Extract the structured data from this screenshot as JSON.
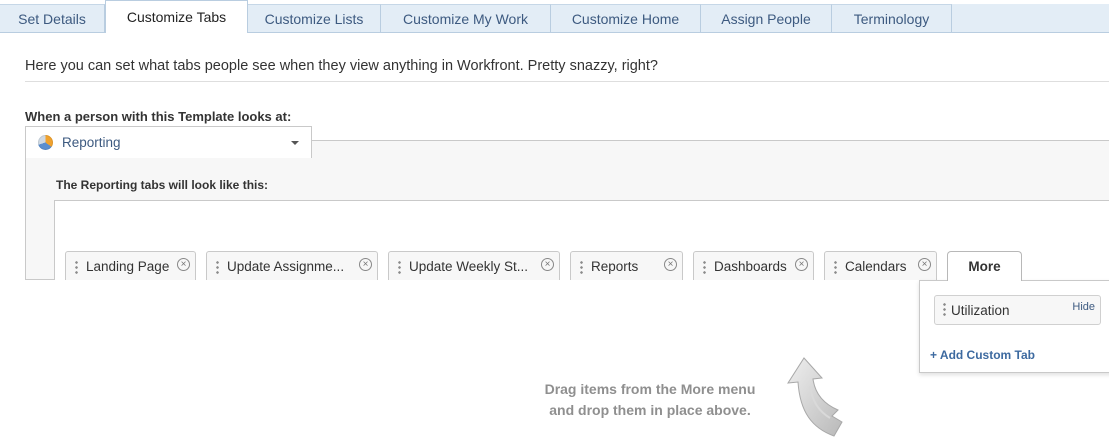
{
  "tabs": [
    {
      "label": "Set Details",
      "active": false
    },
    {
      "label": "Customize Tabs",
      "active": true
    },
    {
      "label": "Customize Lists",
      "active": false
    },
    {
      "label": "Customize My Work",
      "active": false
    },
    {
      "label": "Customize Home",
      "active": false
    },
    {
      "label": "Assign People",
      "active": false
    },
    {
      "label": "Terminology",
      "active": false
    }
  ],
  "intro": "Here you can set what tabs people see when they view anything in Workfront. Pretty snazzy, right?",
  "when_label": "When a person with this Template looks at:",
  "object_select": {
    "value": "Reporting",
    "icon": "reporting-pie-icon"
  },
  "preview_label": "The Reporting tabs will look like this:",
  "preview_tabs": [
    {
      "label": "Landing Page"
    },
    {
      "label": "Update Assignme..."
    },
    {
      "label": "Update Weekly St..."
    },
    {
      "label": "Reports"
    },
    {
      "label": "Dashboards"
    },
    {
      "label": "Calendars"
    }
  ],
  "more_tab": {
    "label": "More"
  },
  "more_menu": {
    "items": [
      {
        "label": "Utilization",
        "hide_label": "Hide"
      }
    ],
    "add_custom_label": "+ Add Custom Tab"
  },
  "hint": {
    "line1": "Drag items from the More menu",
    "line2": "and drop them in place above."
  },
  "colors": {
    "tab_bg": "#e3edf6",
    "link": "#3d5a80",
    "panel_bg": "#f7f7f7",
    "hint_text": "#8f8f8f"
  }
}
